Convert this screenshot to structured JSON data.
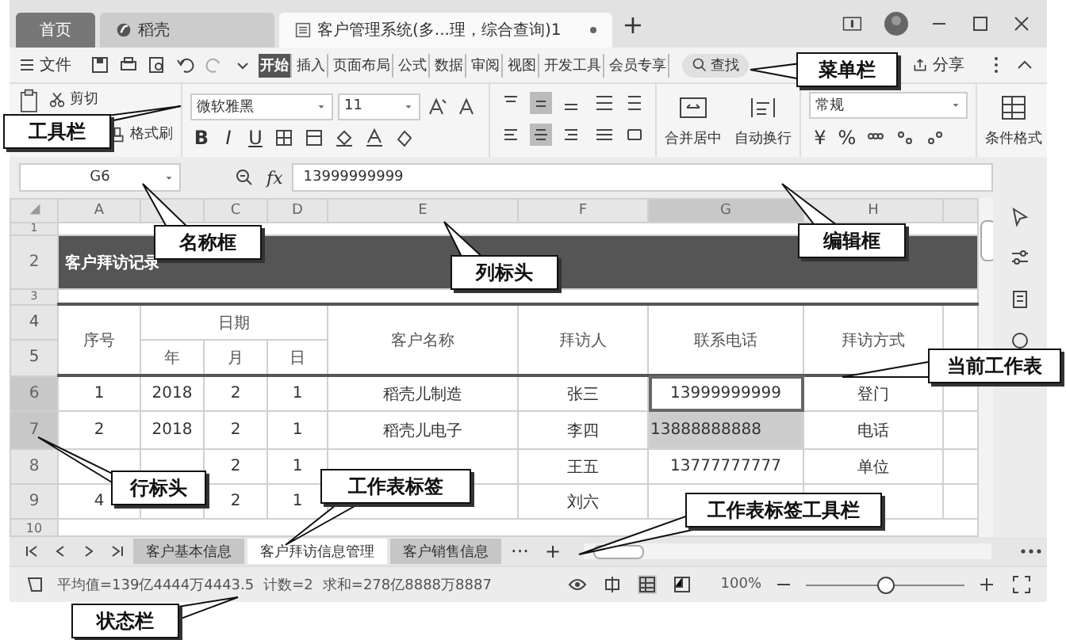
{
  "tabs": [
    {
      "label": "首页",
      "selected": false,
      "kind": "home"
    },
    {
      "label": "稻壳",
      "selected": false,
      "kind": "app"
    },
    {
      "label": "客户管理系统(多...理，综合查询)1",
      "selected": true,
      "kind": "doc"
    }
  ],
  "new_tab": "+",
  "file_menu": "文件",
  "menu_tabs": [
    {
      "label": "开始",
      "selected": true
    },
    {
      "label": "插入",
      "selected": false
    },
    {
      "label": "页面布局",
      "selected": false
    },
    {
      "label": "公式",
      "selected": false
    },
    {
      "label": "数据",
      "selected": false
    },
    {
      "label": "审阅",
      "selected": false
    },
    {
      "label": "视图",
      "selected": false
    },
    {
      "label": "开发工具",
      "selected": false
    },
    {
      "label": "会员专享",
      "selected": false
    }
  ],
  "search": "查找",
  "share": "分享",
  "ribbon": {
    "cut": "剪切",
    "format_painter": "格式刷",
    "font": "微软雅黑",
    "size": "11",
    "bold": "B",
    "italic": "I",
    "underline": "U",
    "merge": "合并居中",
    "wrap": "自动换行",
    "number_format": "常规",
    "currency": "¥",
    "percent": "%",
    "conditional": "条件格式"
  },
  "name_box": "G6",
  "fx": "fx",
  "formula": "13999999999",
  "columns": [
    {
      "label": "A",
      "selected": false
    },
    {
      "selected": false
    },
    {
      "label": "C",
      "selected": false
    },
    {
      "label": "D",
      "selected": false
    },
    {
      "label": "E",
      "selected": false
    },
    {
      "label": "F",
      "selected": false
    },
    {
      "label": "G",
      "selected": true
    },
    {
      "label": "H",
      "selected": false
    }
  ],
  "row_numbers": [
    {
      "label": "1",
      "selected": false
    },
    {
      "label": "2",
      "selected": false
    },
    {
      "label": "3",
      "selected": false
    },
    {
      "label": "4",
      "selected": false
    },
    {
      "label": "5",
      "selected": false
    },
    {
      "label": "6",
      "selected": true
    },
    {
      "label": "7",
      "selected": true
    },
    {
      "label": "8",
      "selected": false
    },
    {
      "label": "9",
      "selected": false
    },
    {
      "label": "10",
      "selected": false
    }
  ],
  "title": "客户拜访记录",
  "header": {
    "seq": "序号",
    "date": "日期",
    "year": "年",
    "month": "月",
    "day": "日",
    "customer": "客户名称",
    "visitor": "拜访人",
    "phone": "联系电话",
    "method": "拜访方式"
  },
  "rows": [
    {
      "seq": "1",
      "year": "2018",
      "month": "2",
      "day": "1",
      "customer": "稻壳儿制造",
      "visitor": "张三",
      "phone": "13999999999",
      "method": "登门",
      "phone_selected": true
    },
    {
      "seq": "2",
      "year": "2018",
      "month": "2",
      "day": "1",
      "customer": "稻壳儿电子",
      "visitor": "李四",
      "phone": "13888888888",
      "method": "电话",
      "phone_selected": true
    },
    {
      "month": "2",
      "day": "1",
      "visitor": "王五",
      "phone": "13777777777",
      "method": "单位",
      "phone_selected": false
    },
    {
      "seq": "4",
      "month": "2",
      "day": "1",
      "visitor": "刘六",
      "phone_selected": false
    }
  ],
  "sheet_tabs": [
    {
      "label": "客户基本信息",
      "selected": false
    },
    {
      "label": "客户拜访信息管理",
      "selected": true
    },
    {
      "label": "客户销售信息",
      "selected": false
    }
  ],
  "more_tabs": "···",
  "add_sheet": "+",
  "status": {
    "average": "平均值=139亿4444万4443.5",
    "count": "计数=2",
    "sum": "求和=278亿8888万8887",
    "zoom": "100%",
    "zoom_slider": {
      "level": 0.5
    }
  },
  "callouts": [
    "菜单栏",
    "工具栏",
    "名称框",
    "列标头",
    "编辑框",
    "当前工作表",
    "行标头",
    "工作表标签",
    "工作表标签工具栏",
    "状态栏"
  ]
}
